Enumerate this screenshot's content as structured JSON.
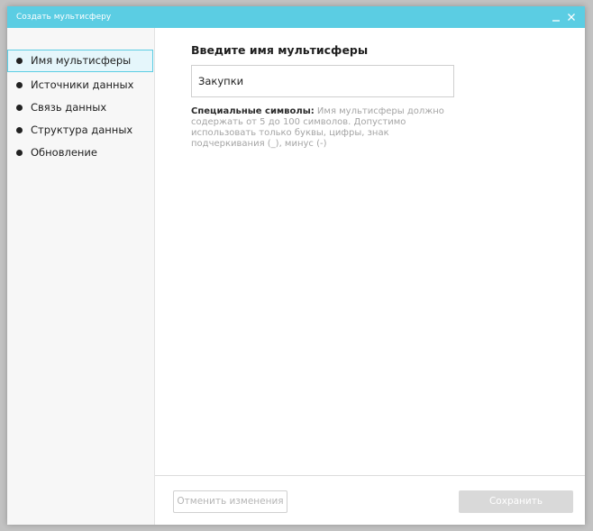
{
  "window": {
    "title": "Создать мультисферу",
    "minimize_icon": "minus-icon",
    "close_icon": "close-icon",
    "accent_color": "#5bcde3"
  },
  "sidebar": {
    "items": [
      {
        "label": "Имя мультисферы",
        "active": true
      },
      {
        "label": "Источники данных",
        "active": false
      },
      {
        "label": "Связь данных",
        "active": false
      },
      {
        "label": "Структура данных",
        "active": false
      },
      {
        "label": "Обновление",
        "active": false
      }
    ]
  },
  "main": {
    "field_title": "Введите имя мультисферы",
    "name_input": {
      "value": "Закупки",
      "placeholder": ""
    },
    "hint": {
      "label": "Специальные символы:",
      "text": "Имя мультисферы должно содержать от 5 до 100 символов. Допустимо использовать только буквы, цифры, знак подчеркивания (_), минус (-)"
    }
  },
  "footer": {
    "reset_label": "Отменить изменения",
    "save_label": "Сохранить"
  }
}
